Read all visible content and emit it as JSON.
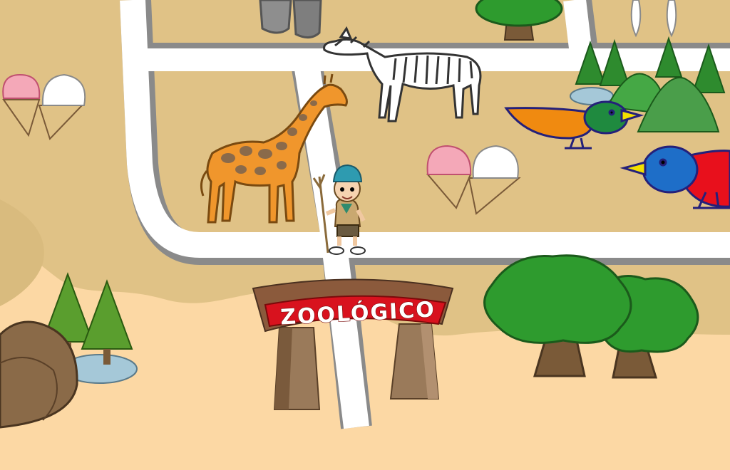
{
  "scene": {
    "sign": {
      "title": "ZOOLÓGICO"
    },
    "colors": {
      "ground_outer": "#fcd8a4",
      "ground_zoo": "#e0c286",
      "path": "#ffffff",
      "path_edge": "#8a8a8a",
      "sign_red": "#d8121e",
      "sign_brown": "#8b5a3c",
      "tree_green": "#2e9b2e",
      "trunk": "#7a5a38"
    },
    "characters": [
      {
        "id": "explorer",
        "kind": "child explorer with stick",
        "icon": "explorer-icon"
      }
    ],
    "animals": [
      "giraffe",
      "zebra",
      "elephant",
      "orange-bird",
      "blue-bird"
    ],
    "items": [
      "ice-cream-cones",
      "trees",
      "pond",
      "fountain",
      "rock"
    ]
  }
}
